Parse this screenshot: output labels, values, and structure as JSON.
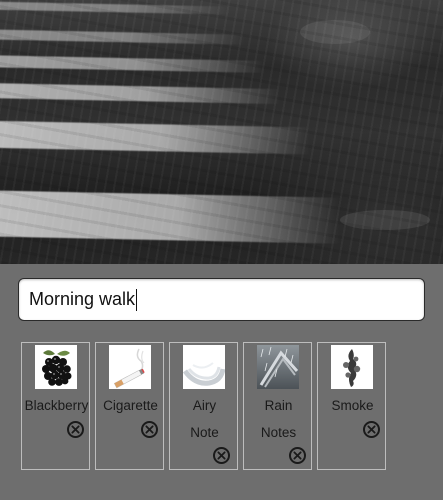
{
  "name_field": {
    "value": "Morning walk"
  },
  "sounds": [
    {
      "label": "Blackberry",
      "label2": "",
      "icon": "blackberry-icon"
    },
    {
      "label": "Cigarette",
      "label2": "",
      "icon": "cigarette-icon"
    },
    {
      "label": "Airy",
      "label2": "Note",
      "icon": "airy-note-icon"
    },
    {
      "label": "Rain",
      "label2": "Notes",
      "icon": "rain-notes-icon"
    },
    {
      "label": "Smoke",
      "label2": "",
      "icon": "smoke-icon"
    }
  ],
  "colors": {
    "panel_background": "#6e6e6e",
    "card_border": "#bdbdbd",
    "input_background": "#ffffff"
  }
}
